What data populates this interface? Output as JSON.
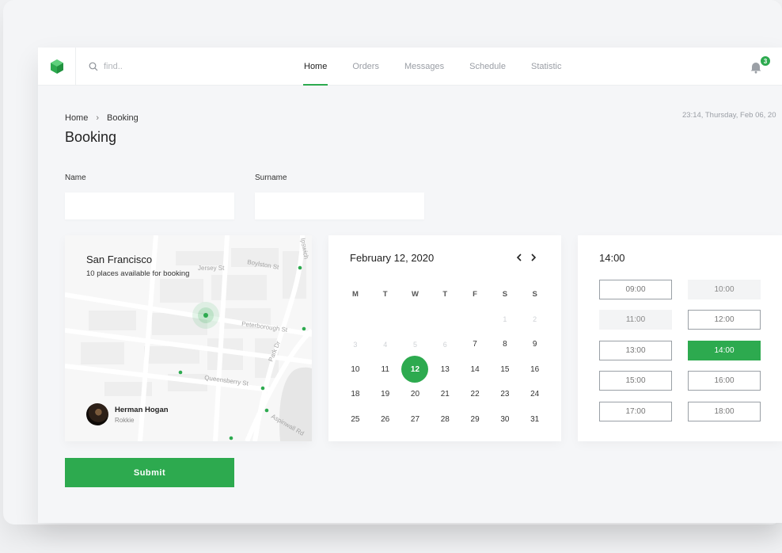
{
  "header": {
    "search_placeholder": "find..",
    "nav": [
      {
        "label": "Home",
        "active": true
      },
      {
        "label": "Orders",
        "active": false
      },
      {
        "label": "Messages",
        "active": false
      },
      {
        "label": "Schedule",
        "active": false
      },
      {
        "label": "Statistic",
        "active": false
      }
    ],
    "notification_count": "3"
  },
  "page": {
    "breadcrumb": [
      "Home",
      "Booking"
    ],
    "title": "Booking",
    "datetime": "23:14, Thursday, Feb 06, 20"
  },
  "form": {
    "name_label": "Name",
    "name_value": "",
    "surname_label": "Surname",
    "surname_value": "",
    "submit_label": "Submit"
  },
  "map": {
    "city": "San Francisco",
    "subtitle": "10 places available for booking",
    "streets": [
      "Boylston St",
      "Peterborough St",
      "Queensberry St",
      "Park Dr",
      "Jersey St",
      "Aspinwall Rd",
      "Ipswich"
    ],
    "person": {
      "name": "Herman Hogan",
      "role": "Rokkie"
    }
  },
  "calendar": {
    "title": "February 12, 2020",
    "weekdays": [
      "M",
      "T",
      "W",
      "T",
      "F",
      "S",
      "S"
    ],
    "weeks": [
      [
        {
          "d": ""
        },
        {
          "d": ""
        },
        {
          "d": ""
        },
        {
          "d": ""
        },
        {
          "d": ""
        },
        {
          "d": "1",
          "muted": true
        },
        {
          "d": "2",
          "muted": true
        }
      ],
      [
        {
          "d": "3",
          "muted": true
        },
        {
          "d": "4",
          "muted": true
        },
        {
          "d": "5",
          "muted": true
        },
        {
          "d": "6",
          "muted": true
        },
        {
          "d": "7"
        },
        {
          "d": "8"
        },
        {
          "d": "9"
        }
      ],
      [
        {
          "d": "10"
        },
        {
          "d": "11"
        },
        {
          "d": "12",
          "selected": true
        },
        {
          "d": "13"
        },
        {
          "d": "14"
        },
        {
          "d": "15"
        },
        {
          "d": "16"
        }
      ],
      [
        {
          "d": "18"
        },
        {
          "d": "19"
        },
        {
          "d": "20"
        },
        {
          "d": "21"
        },
        {
          "d": "22"
        },
        {
          "d": "23"
        },
        {
          "d": "24"
        }
      ],
      [
        {
          "d": "25"
        },
        {
          "d": "26"
        },
        {
          "d": "27"
        },
        {
          "d": "28"
        },
        {
          "d": "29"
        },
        {
          "d": "30"
        },
        {
          "d": "31"
        }
      ]
    ]
  },
  "time": {
    "title": "14:00",
    "slots": [
      {
        "label": "09:00",
        "state": "available"
      },
      {
        "label": "10:00",
        "state": "unavailable"
      },
      {
        "label": "11:00",
        "state": "unavailable"
      },
      {
        "label": "12:00",
        "state": "available"
      },
      {
        "label": "13:00",
        "state": "available"
      },
      {
        "label": "14:00",
        "state": "selected"
      },
      {
        "label": "15:00",
        "state": "available"
      },
      {
        "label": "16:00",
        "state": "available"
      },
      {
        "label": "17:00",
        "state": "available"
      },
      {
        "label": "18:00",
        "state": "available"
      }
    ]
  },
  "colors": {
    "accent": "#2daa4f"
  }
}
